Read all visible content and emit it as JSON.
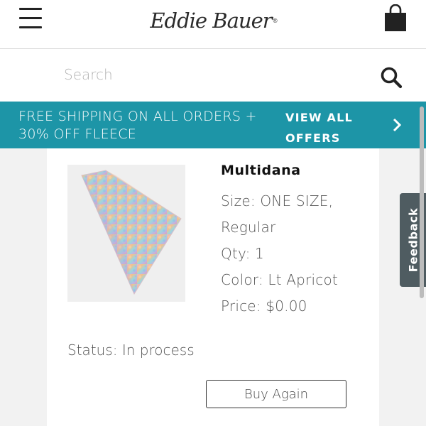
{
  "header": {
    "menu_icon": "hamburger-menu-icon",
    "brand_name": "Eddie Bauer",
    "brand_mark": "®",
    "bag_icon": "shopping-bag-icon"
  },
  "search": {
    "placeholder": "Search",
    "value": "",
    "icon": "search-icon"
  },
  "promo": {
    "line1": "FREE SHIPPING ON ALL ORDERS +",
    "line2": "30% OFF FLEECE",
    "link_line1": "VIEW ALL",
    "link_line2": "OFFERS",
    "chevron_icon": "chevron-right-icon",
    "background_color": "#1d95a7"
  },
  "order_item": {
    "name": "Multidana",
    "size_line1": "Size: ONE SIZE,",
    "size_line2": "Regular",
    "qty": "Qty: 1",
    "color": "Color: Lt Apricot",
    "price": "Price: $0.00",
    "status": "Status: In process",
    "buy_again_label": "Buy Again"
  },
  "feedback": {
    "label": "Feedback"
  }
}
